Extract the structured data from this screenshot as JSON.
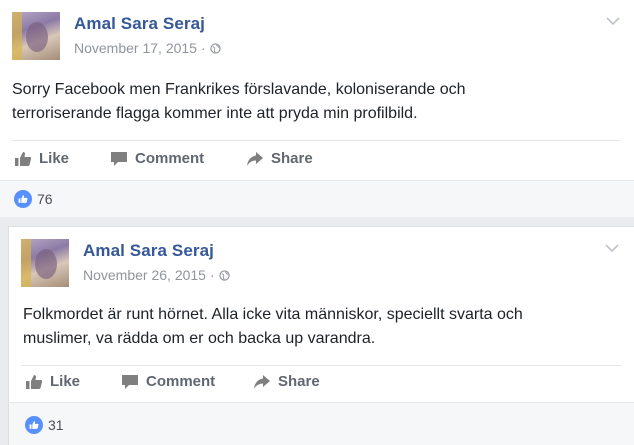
{
  "posts": [
    {
      "author": "Amal Sara Seraj",
      "date": "November 17, 2015 · ",
      "text": "Sorry Facebook men Frankrikes förslavande, koloniserande och terroriserande flagga kommer inte att pryda min profilbild.",
      "actions": {
        "like": "Like",
        "comment": "Comment",
        "share": "Share"
      },
      "like_count": "76"
    },
    {
      "author": "Amal Sara Seraj",
      "date": "November 26, 2015 · ",
      "text": "Folkmordet är runt hörnet. Alla icke vita människor, speciellt svarta och muslimer, va rädda om er och backa up varandra.",
      "actions": {
        "like": "Like",
        "comment": "Comment",
        "share": "Share"
      },
      "like_count": "31"
    }
  ],
  "colors": {
    "author": "#365899",
    "meta": "#90949c",
    "action": "#616770",
    "like_badge": "#5890ff",
    "feed_bg": "#e9ebee"
  },
  "icons": [
    "avatar",
    "globe-icon",
    "chevron-down-icon",
    "like-icon",
    "comment-icon",
    "share-icon",
    "like-badge-icon"
  ]
}
